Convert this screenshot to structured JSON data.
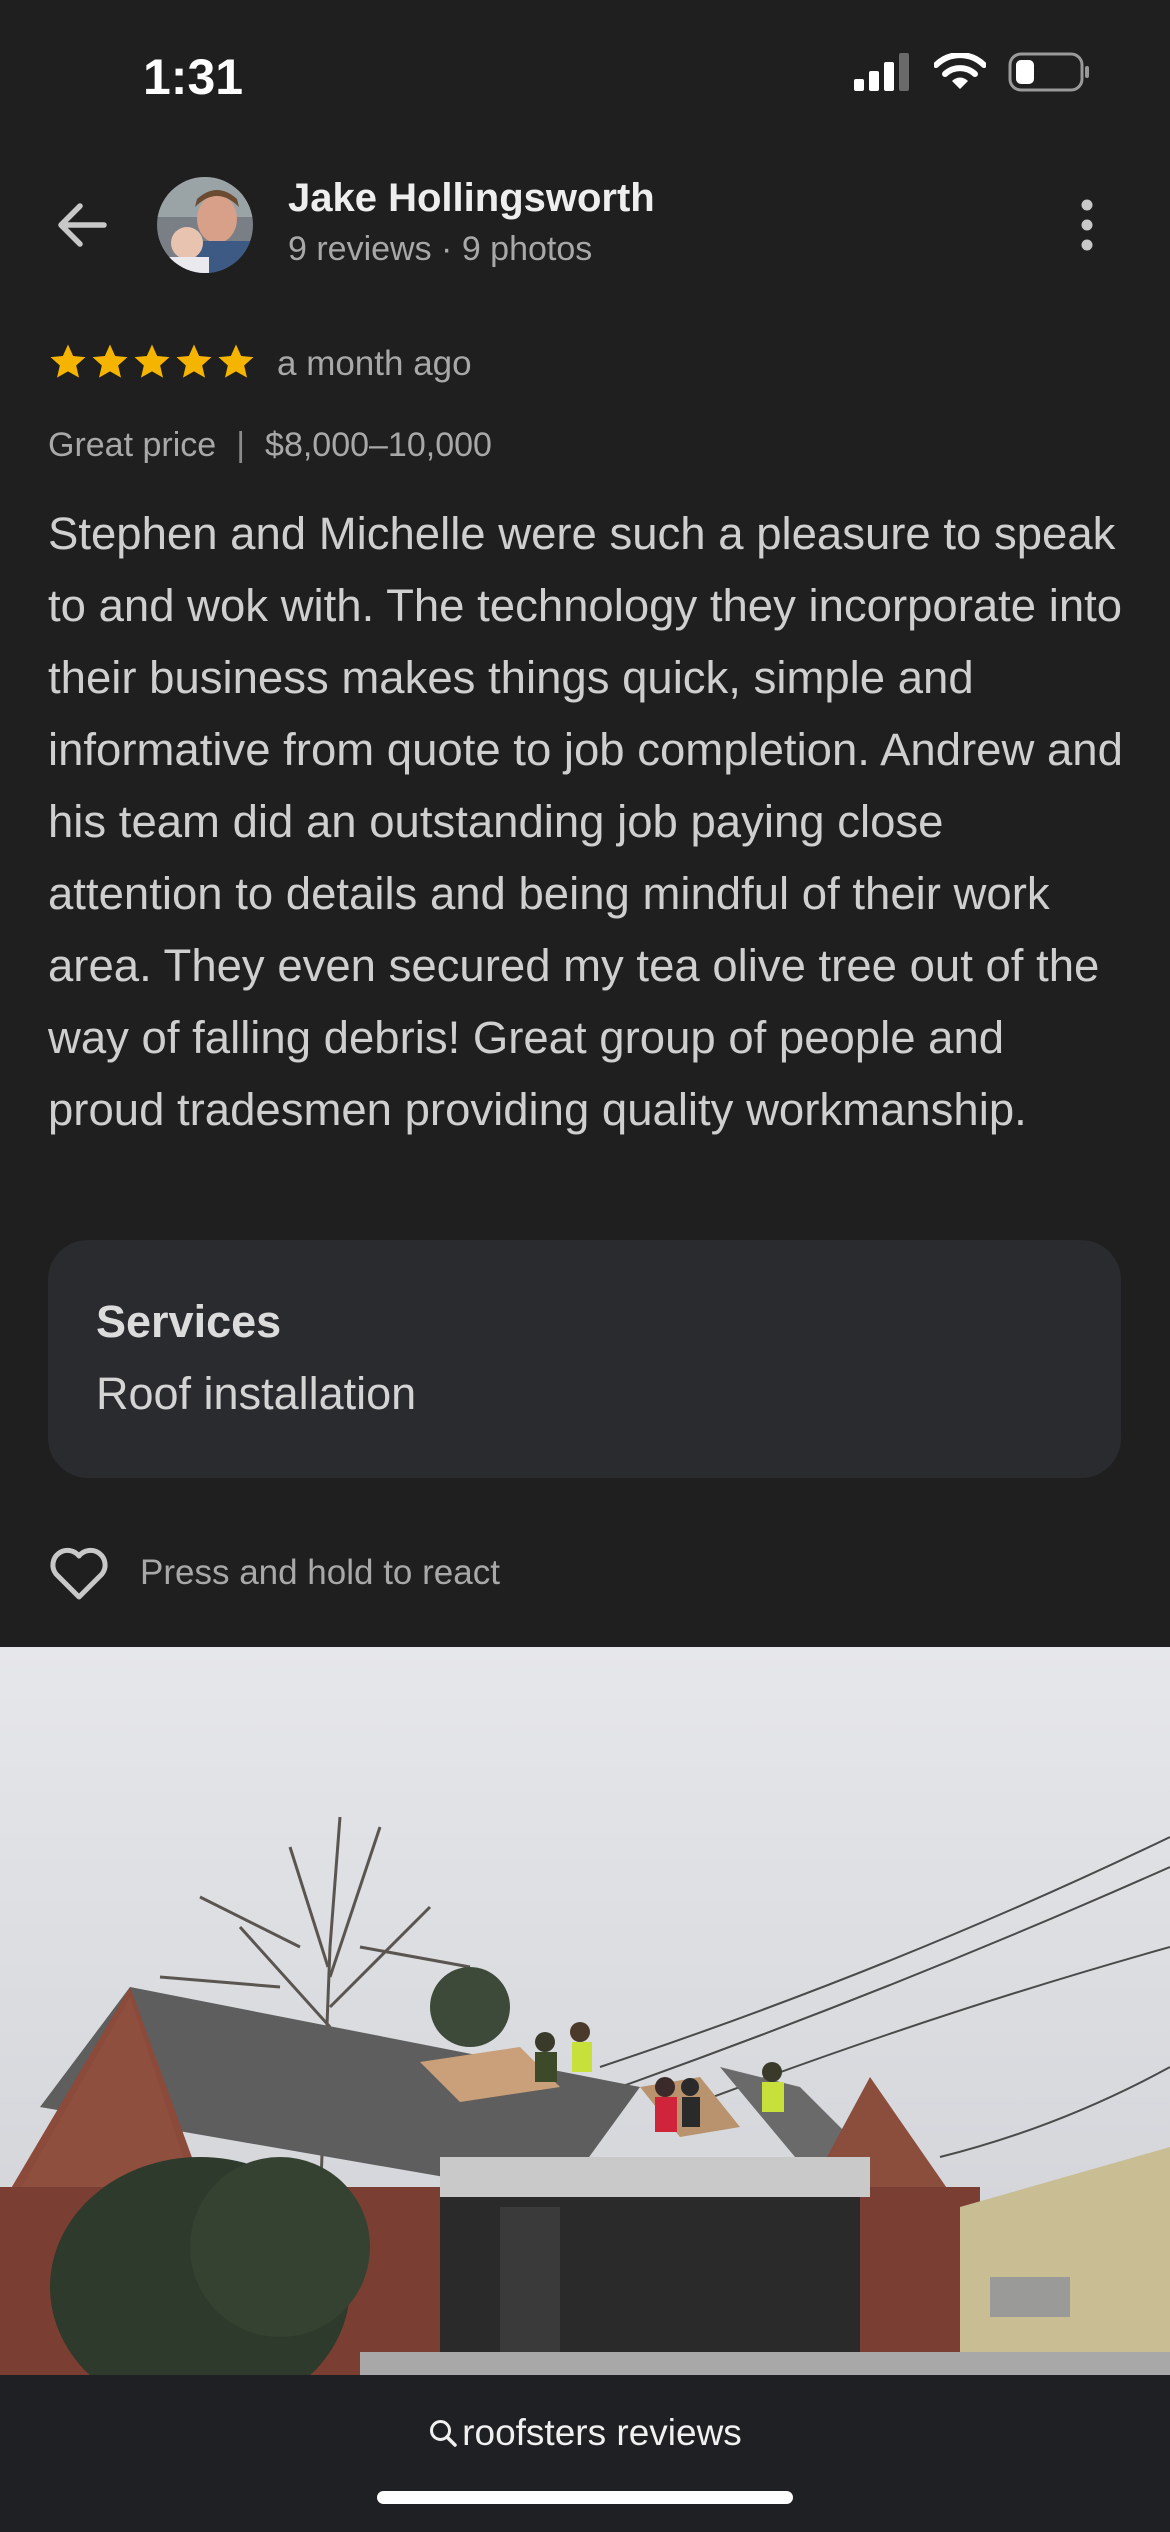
{
  "status_bar": {
    "time": "1:31"
  },
  "reviewer": {
    "name": "Jake Hollingsworth",
    "stats": "9 reviews · 9 photos"
  },
  "review": {
    "rating": 5,
    "time_ago": "a month ago",
    "price_label": "Great price",
    "price_range": "$8,000–10,000",
    "text": "Stephen and Michelle were such a pleasure to speak to and wok with. The technology they incorporate into their business makes things quick, simple and informative from quote to job completion. Andrew and his team did an outstanding job paying close attention to details and being mindful of their work area. They even secured my tea olive tree out of the way of falling debris! Great group of people and proud tradesmen providing quality workmanship.",
    "services_title": "Services",
    "services_value": "Roof installation",
    "react_hint": "Press and hold to react"
  },
  "bottom_search": {
    "query": "roofsters reviews"
  },
  "colors": {
    "star": "#f5b400",
    "background": "#1f1f1f",
    "card": "#2a2b2e"
  }
}
